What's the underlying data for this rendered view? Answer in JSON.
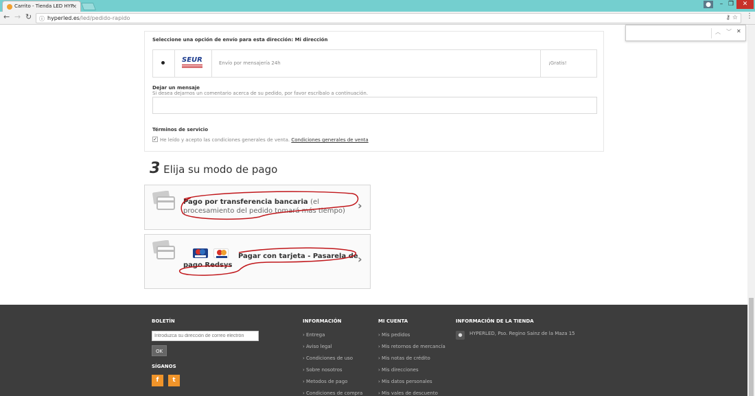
{
  "browser": {
    "tab_title": "Carrito - Tienda LED HYP",
    "url_domain": "hyperled.es",
    "url_path": "/led/pedido-rapido"
  },
  "shipping": {
    "heading": "Seleccione una opción de envío para esta dirección: Mi dirección",
    "carrier_logo": "SEUR",
    "carrier_desc": "Envío por mensajería 24h",
    "price": "¡Gratis!"
  },
  "message": {
    "label": "Dejar un mensaje",
    "help": "Si desea dejarnos un comentario acerca de su pedido, por favor escríbalo a continuación."
  },
  "terms": {
    "label": "Términos de servicio",
    "text": "He leído y acepto las condiciones generales de venta.",
    "link": "Condiciones generales de venta"
  },
  "payment": {
    "step_number": "3",
    "step_title": "Elija su modo de pago",
    "options": [
      {
        "label": "Pago por transferencia bancaria",
        "note": "(el procesamiento del pedido tomará más tiempo)"
      },
      {
        "label": "Pagar con tarjeta - Pasarela de pago Redsys"
      }
    ]
  },
  "footer": {
    "boletin": {
      "heading": "BOLETÍN",
      "placeholder": "Introduzca su dirección de correo electrón",
      "ok": "OK"
    },
    "siganos": "SÍGANOS",
    "informacion": {
      "heading": "INFORMACIÓN",
      "links": [
        "Entrega",
        "Aviso legal",
        "Condiciones de uso",
        "Sobre nosotros",
        "Metodos de pago",
        "Condiciones de compra"
      ]
    },
    "mi_cuenta": {
      "heading": "MI CUENTA",
      "links": [
        "Mis pedidos",
        "Mis retornos de mercancía",
        "Mis notas de crédito",
        "Mis direcciones",
        "Mis datos personales",
        "Mis vales de descuento"
      ]
    },
    "tienda": {
      "heading": "INFORMACIÓN DE LA TIENDA",
      "address": "HYPERLED, Pso. Regino Sainz de la Maza 15"
    }
  },
  "colors": {
    "tabstrip": "#74cfcf",
    "footer": "#3d3d3d",
    "social": "#f0942a",
    "annotation": "#c0161a"
  },
  "icons": [
    "favicon",
    "back-arrow-icon",
    "forward-arrow-icon",
    "reload-icon",
    "info-icon",
    "key-icon",
    "star-icon",
    "menu-dots-icon",
    "chevron-up-icon",
    "chevron-down-icon",
    "close-icon",
    "card-icon",
    "chevron-right-icon",
    "facebook-icon",
    "twitter-icon",
    "location-pin-icon"
  ]
}
